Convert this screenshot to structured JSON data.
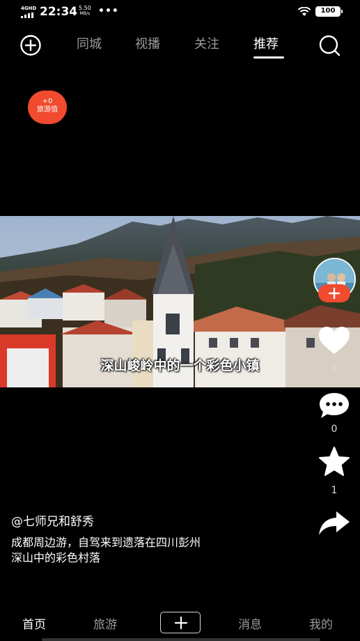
{
  "status_bar": {
    "network": "4GHD",
    "time": "22:34",
    "speed_value": "5.50",
    "speed_unit": "MB/s",
    "more": "•••",
    "battery": "100"
  },
  "top_nav": {
    "tabs": [
      "同城",
      "视播",
      "关注",
      "推荐"
    ],
    "active_tab": "推荐",
    "add_icon": "add-circle-icon",
    "search_icon": "search-icon"
  },
  "travel_badge": {
    "value": "+0",
    "label": "旅游值",
    "color": "#f04a2f"
  },
  "video": {
    "caption": "深山峻岭中的一个彩色小镇"
  },
  "actions": {
    "likes": "1",
    "comments": "0",
    "favorites": "1",
    "follow_icon": "plus-icon",
    "like_icon": "heart-icon",
    "comment_icon": "comment-icon",
    "favorite_icon": "star-icon",
    "share_icon": "share-arrow-icon"
  },
  "post": {
    "author": "@七师兄和舒秀",
    "description_line1": "成都周边游，自驾来到遗落在四川彭州",
    "description_line2": "深山中的彩色村落"
  },
  "bottom_nav": {
    "home": "首页",
    "travel": "旅游",
    "messages": "消息",
    "me": "我的",
    "active": "首页"
  }
}
